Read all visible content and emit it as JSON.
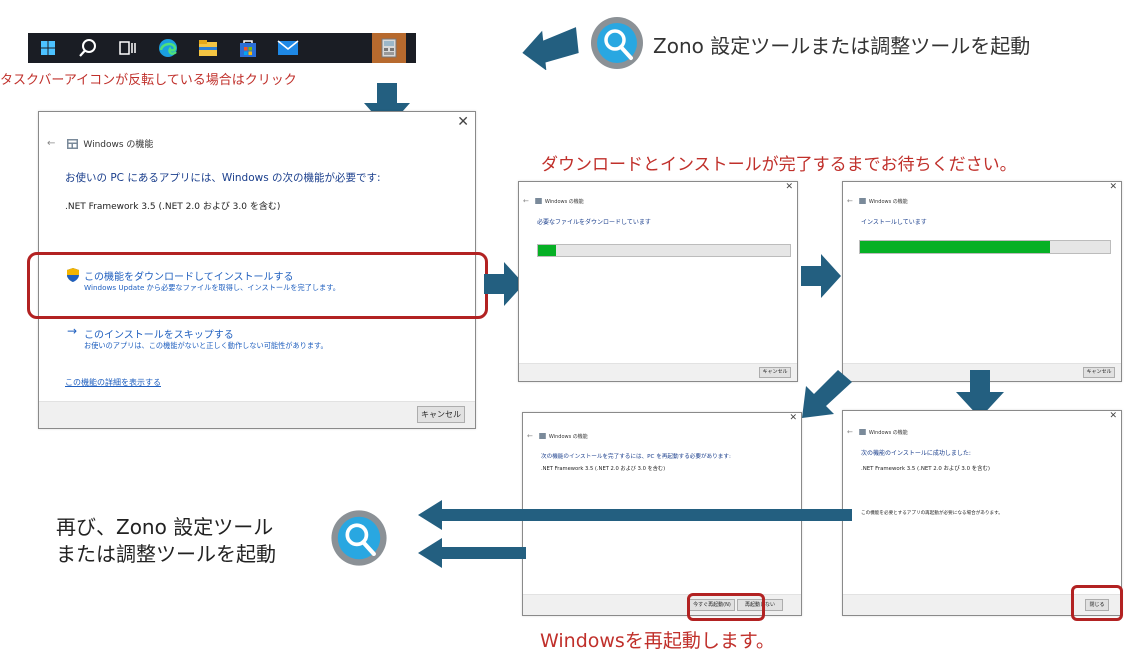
{
  "taskbar": {
    "icons": [
      "windows-start-icon",
      "search-icon",
      "task-view-icon",
      "edge-icon",
      "file-explorer-icon",
      "store-icon",
      "mail-icon",
      "zono-app-icon"
    ],
    "hint": "タスクバーアイコンが反転している場合はクリック"
  },
  "launch_caption": "Zono 設定ツールまたは調整ツールを起動",
  "relaunch_caption_line1": "再び、Zono 設定ツール",
  "relaunch_caption_line2": "または調整ツールを起動",
  "wait_caption": "ダウンロードとインストールが完了するまでお待ちください。",
  "restart_caption": "Windowsを再起動します。",
  "main_dialog": {
    "title": "Windows の機能",
    "heading": "お使いの PC にあるアプリには、Windows の次の機能が必要です:",
    "feature": ".NET Framework 3.5 (.NET 2.0 および 3.0 を含む)",
    "option1_title": "この機能をダウンロードしてインストールする",
    "option1_desc": "Windows Update から必要なファイルを取得し、インストールを完了します。",
    "option2_title": "このインストールをスキップする",
    "option2_desc": "お使いのアプリは、この機能がないと正しく動作しない可能性があります。",
    "details_link": "この機能の詳細を表示する",
    "cancel": "キャンセル"
  },
  "download_dialog": {
    "title": "Windows の機能",
    "status": "必要なファイルをダウンロードしています",
    "progress": 0.07,
    "cancel": "キャンセル"
  },
  "install_dialog": {
    "title": "Windows の機能",
    "status": "インストールしています",
    "progress": 0.76,
    "cancel": "キャンセル"
  },
  "restart_dialog": {
    "title": "Windows の機能",
    "heading": "次の機能のインストールを完了するには、PC を再起動する必要があります:",
    "feature": ".NET Framework 3.5 (.NET 2.0 および 3.0 を含む)",
    "restart_now": "今すぐ再起動(N)",
    "restart_later": "再起動しない"
  },
  "success_dialog": {
    "title": "Windows の機能",
    "heading": "次の機能のインストールに成功しました:",
    "feature": ".NET Framework 3.5 (.NET 2.0 および 3.0 を含む)",
    "note": "この機能を必要とするアプリの再起動が必要になる場合があります。",
    "close": "閉じる"
  },
  "colors": {
    "arrow": "#235f80",
    "highlight": "#b22222",
    "progress": "#06b025",
    "link": "#1f5fbf",
    "caption_red": "#c0302b"
  }
}
